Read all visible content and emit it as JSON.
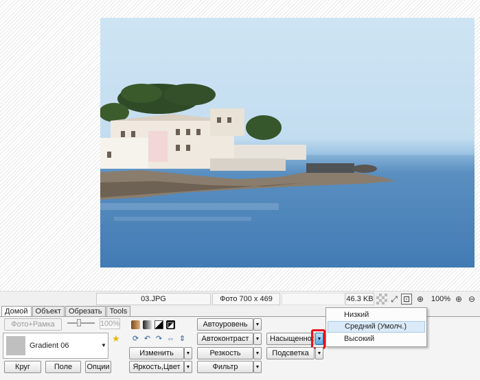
{
  "statusbar": {
    "filename": "03.JPG",
    "photo_info": "Фото 700 x 469",
    "file_size": "46.3 KB",
    "zoom": "100%",
    "icons": [
      "checker-icon",
      "fit-icon",
      "actual-size-icon",
      "zoom-fit-icon",
      "zoom-in-icon",
      "zoom-out-icon"
    ]
  },
  "tabs": [
    "Домой",
    "Объект",
    "Обрезать",
    "Tools"
  ],
  "panel": {
    "photo_frame_button": "Фото+Рамка",
    "opacity_value": "100%",
    "gradient_name": "Gradient 06",
    "bottom_buttons": [
      "Круг",
      "Поле",
      "Опции"
    ],
    "change_button": "Изменить",
    "brightness_button": "Яркость,Цвет",
    "auto_level_button": "Автоуровень",
    "auto_contrast_button": "Автоконтраст",
    "sharpness_button": "Резкость",
    "filter_button": "Фильтр",
    "saturation_button": "Насыщенность",
    "backlight_button": "Подсветка"
  },
  "saturation_menu": {
    "items": [
      "Низкий",
      "Средний (Умолч.)",
      "Высокий"
    ],
    "hovered_index": 1
  },
  "colors": {
    "highlight": "#e8101c",
    "hot_arrow": "#5aa8e3",
    "menu_hover": "#dbeaf8"
  }
}
